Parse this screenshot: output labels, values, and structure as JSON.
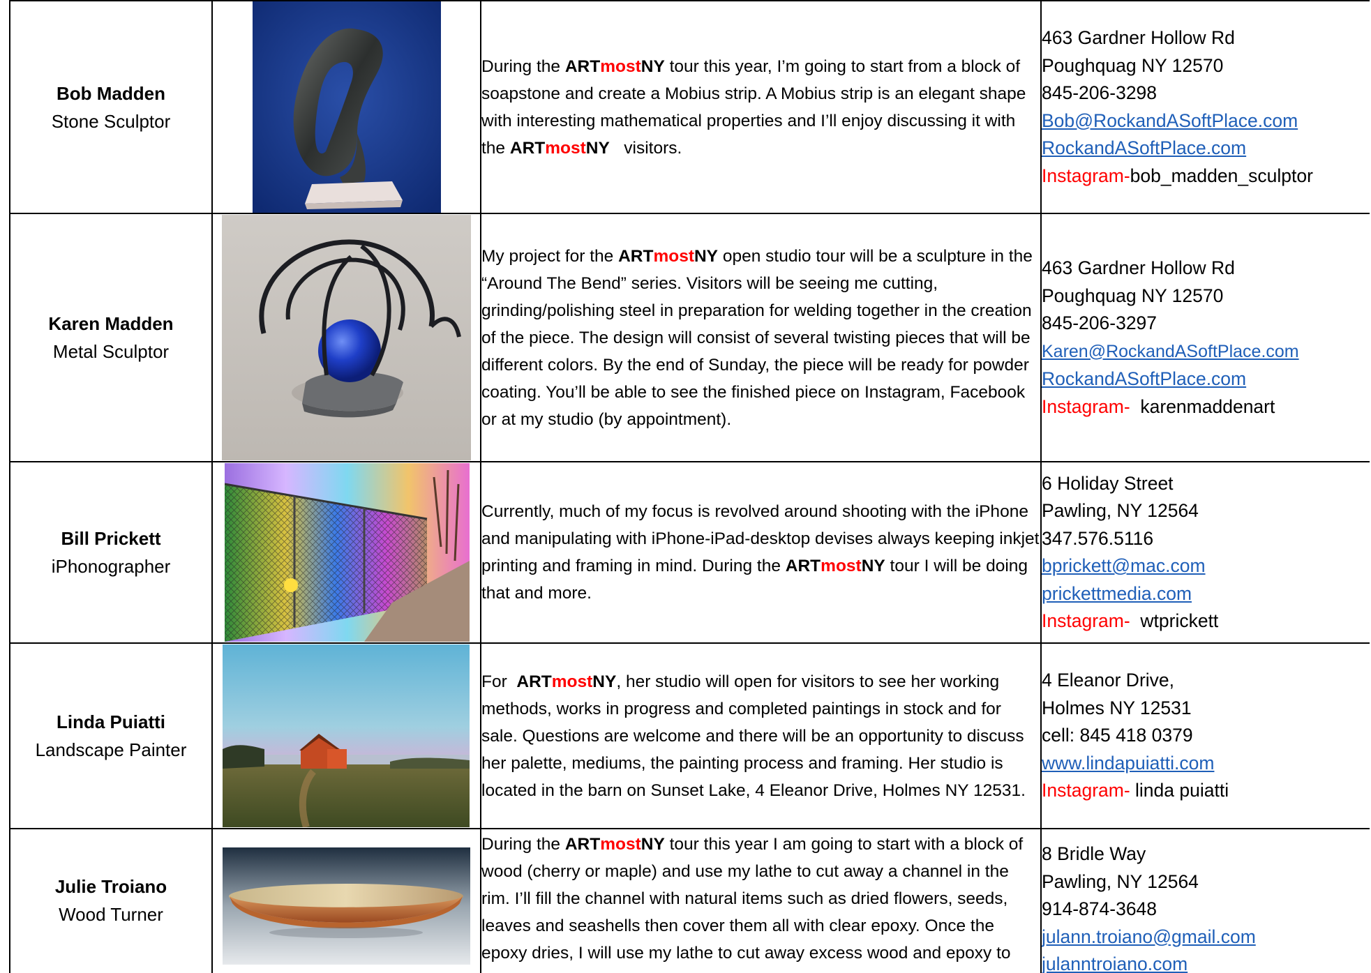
{
  "brand": {
    "part1": "ART",
    "part2": "most",
    "part3": "NY"
  },
  "colors": {
    "brand_accent": "#ff0000",
    "link": "#1f5fb8",
    "border": "#000000"
  },
  "artists": [
    {
      "name": "Bob Madden",
      "role": "Stone Sculptor",
      "image": "stone-mobius-sculpture",
      "desc_before": "During the ",
      "desc_after": " tour this year, I’m going to start from a block of soapstone and create a Mobius strip.  A Mobius strip is an elegant shape with interesting mathematical properties and I’ll enjoy discussing it with the ",
      "desc_end": "   visitors.",
      "address1": "463 Gardner Hollow Rd",
      "address2": "Poughquag NY 12570",
      "phone": "845-206-3298",
      "email": "Bob@RockandASoftPlace.com",
      "website": "RockandASoftPlace.com",
      "ig_label": "Instagram-",
      "ig_handle": "bob_madden_sculptor"
    },
    {
      "name": "Karen Madden",
      "role": "Metal Sculptor",
      "image": "metal-bend-sculpture",
      "desc_before": "My project for the ",
      "desc_after": " open studio tour will be a sculpture in the “Around The Bend” series. Visitors will be seeing me cutting, grinding/polishing steel in preparation for welding together in the creation of the piece. The design will consist of several twisting pieces that will be different colors. By the end of Sunday, the piece will be ready for powder coating. You’ll be able to see the finished piece on Instagram, Facebook or at my studio (by appointment).",
      "address1": "463 Gardner Hollow Rd",
      "address2": "Poughquag NY 12570",
      "phone": "845-206-3297",
      "email": "Karen@RockandASoftPlace.com",
      "website": "RockandASoftPlace.com",
      "ig_label": "Instagram-",
      "ig_handle": "  karenmaddenart"
    },
    {
      "name": "Bill Prickett",
      "role": "iPhonographer",
      "image": "iphone-fence-photo",
      "desc_before": "Currently, much of my focus is revolved around shooting with the iPhone and manipulating with iPhone-iPad-desktop devises always keeping inkjet printing and framing in mind. During the ",
      "desc_after": " tour I will be doing that and more.",
      "address1": "6 Holiday Street",
      "address2": "Pawling, NY 12564",
      "phone": "347.576.5116",
      "email": "bprickett@mac.com",
      "website": "prickettmedia.com",
      "ig_label": "Instagram-",
      "ig_handle": "  wtprickett"
    },
    {
      "name": "Linda Puiatti",
      "role": "Landscape Painter",
      "image": "barn-landscape-painting",
      "desc_before": "For  ",
      "desc_after": ",  her studio will open for visitors to see her working methods, works in progress and completed paintings in stock and for sale. Questions are welcome and there will be an opportunity to discuss her palette, mediums, the painting process and framing. Her studio is located in the barn on Sunset Lake, 4 Eleanor Drive, Holmes NY 12531.",
      "address1": "4 Eleanor Drive,",
      "address2": "Holmes NY 12531",
      "phone": "cell: 845 418 0379",
      "website": "www.lindapuiatti.com",
      "ig_label": "Instagram-",
      "ig_handle": " linda puiatti"
    },
    {
      "name": "Julie Troiano",
      "role": "Wood Turner",
      "image": "turned-wood-bowl",
      "desc_before": "During the ",
      "desc_after": " tour this year I am going to start with a block of wood (cherry or maple) and use my lathe to cut away a channel in the rim. I’ll fill the channel with natural items such as dried flowers, seeds, leaves and seashells then cover them all with clear epoxy. Once the epoxy dries, I will use my lathe to cut away excess wood and epoxy to create a beautiful bowl with a",
      "address1": "8 Bridle Way",
      "address2": "Pawling, NY 12564",
      "phone": "914-874-3648",
      "email": "julann.troiano@gmail.com",
      "website": "julanntroiano.com"
    }
  ]
}
